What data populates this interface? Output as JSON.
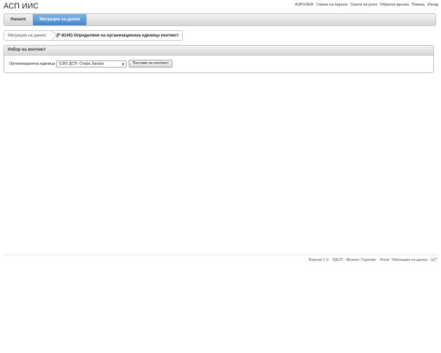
{
  "app": {
    "title": "АСП ИИС"
  },
  "top_links": {
    "user": "ASPUSER",
    "change_password": "Смяна на парола",
    "change_role": "Смяна на роля",
    "feedback": "Обратна връзка",
    "help": "Помощ",
    "logout": "Изход"
  },
  "nav": {
    "home": "Начало",
    "migration": "Миграция на данни"
  },
  "breadcrumb": {
    "item1": "Миграция на данни",
    "item2": "(F-8140) Определяне на организационна единица контекст"
  },
  "panel": {
    "header": "Избор на контекст",
    "org_label": "Организационна единица",
    "org_selected": "(130) ДСП- Стара Загора",
    "set_button": "Постави за контекст"
  },
  "footer": {
    "version": "Версия 1.0",
    "unit": "РДСП - Велико Търново",
    "roles": "Роли: \"Миграция на данни - ЦУ\""
  }
}
